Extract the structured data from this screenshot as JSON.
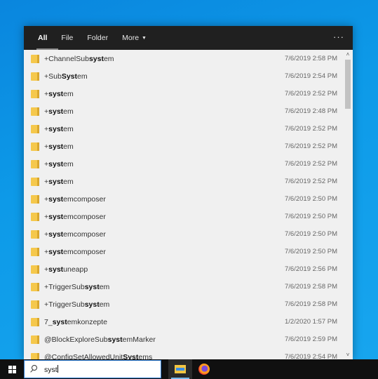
{
  "tabs": [
    {
      "label": "All"
    },
    {
      "label": "File"
    },
    {
      "label": "Folder"
    },
    {
      "label": "More"
    }
  ],
  "header": {
    "more_caret": "▼",
    "options": "···"
  },
  "results": [
    {
      "pre": "+ChannelSub",
      "match": "syst",
      "post": "em",
      "date": "7/6/2019 2:58 PM"
    },
    {
      "pre": "+Sub",
      "match": "Syst",
      "post": "em",
      "date": "7/6/2019 2:54 PM"
    },
    {
      "pre": "+",
      "match": "syst",
      "post": "em",
      "date": "7/6/2019 2:52 PM"
    },
    {
      "pre": "+",
      "match": "syst",
      "post": "em",
      "date": "7/6/2019 2:48 PM"
    },
    {
      "pre": "+",
      "match": "syst",
      "post": "em",
      "date": "7/6/2019 2:52 PM"
    },
    {
      "pre": "+",
      "match": "syst",
      "post": "em",
      "date": "7/6/2019 2:52 PM"
    },
    {
      "pre": "+",
      "match": "syst",
      "post": "em",
      "date": "7/6/2019 2:52 PM"
    },
    {
      "pre": "+",
      "match": "syst",
      "post": "em",
      "date": "7/6/2019 2:52 PM"
    },
    {
      "pre": "+",
      "match": "syst",
      "post": "emcomposer",
      "date": "7/6/2019 2:50 PM"
    },
    {
      "pre": "+",
      "match": "syst",
      "post": "emcomposer",
      "date": "7/6/2019 2:50 PM"
    },
    {
      "pre": "+",
      "match": "syst",
      "post": "emcomposer",
      "date": "7/6/2019 2:50 PM"
    },
    {
      "pre": "+",
      "match": "syst",
      "post": "emcomposer",
      "date": "7/6/2019 2:50 PM"
    },
    {
      "pre": "+",
      "match": "syst",
      "post": "uneapp",
      "date": "7/6/2019 2:56 PM"
    },
    {
      "pre": "+TriggerSub",
      "match": "syst",
      "post": "em",
      "date": "7/6/2019 2:58 PM"
    },
    {
      "pre": "+TriggerSub",
      "match": "syst",
      "post": "em",
      "date": "7/6/2019 2:58 PM"
    },
    {
      "pre": "7_",
      "match": "syst",
      "post": "emkonzepte",
      "date": "1/2/2020 1:57 PM"
    },
    {
      "pre": "@BlockExploreSub",
      "match": "syst",
      "post": "emMarker",
      "date": "7/6/2019 2:59 PM"
    },
    {
      "pre": "@ConfigSetAllowedUnit",
      "match": "Syst",
      "post": "ems",
      "date": "7/6/2019 2:54 PM"
    }
  ],
  "scroll": {
    "up": "˄",
    "down": "˅"
  },
  "taskbar": {
    "search_text": "syst"
  },
  "colors": {
    "folder": "#f5c84c",
    "header_bg": "#202020",
    "desktop": "#0d9ae8"
  }
}
